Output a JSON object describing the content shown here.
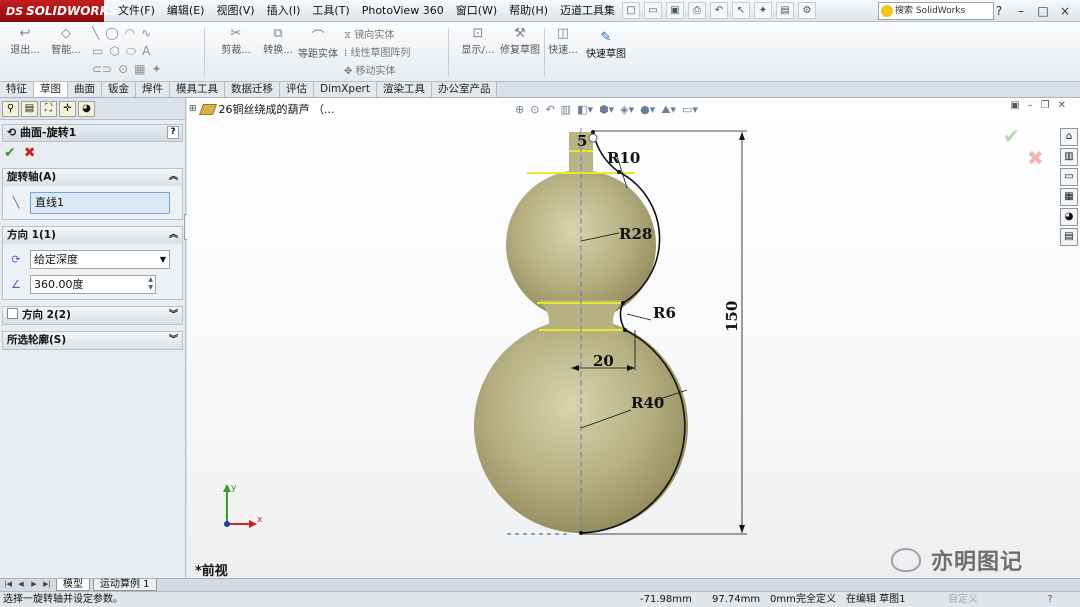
{
  "app": {
    "logo_prefix": "DS",
    "logo_text": "SOLIDWORKS"
  },
  "menu": [
    "文件(F)",
    "编辑(E)",
    "视图(V)",
    "插入(I)",
    "工具(T)",
    "PhotoView 360",
    "窗口(W)",
    "帮助(H)",
    "迈道工具集"
  ],
  "search": {
    "placeholder": "搜索 SolidWorks"
  },
  "window_controls": [
    "?",
    "–",
    "□",
    "×"
  ],
  "commands": {
    "exit_sketch": "退出...",
    "smart_dim": "智能...",
    "trim": "剪裁...",
    "convert": "转换...",
    "offset": "等距实体",
    "mirror": "镜向实体",
    "linear_pattern": "线性草图阵列",
    "move": "移动实体",
    "display": "显示/...",
    "repair": "修复草图",
    "quick_snap": "快速...",
    "rapid_sketch": "快速草图"
  },
  "tabs": [
    {
      "label": "特征",
      "active": false
    },
    {
      "label": "草图",
      "active": true
    },
    {
      "label": "曲面",
      "active": false
    },
    {
      "label": "钣金",
      "active": false
    },
    {
      "label": "焊件",
      "active": false
    },
    {
      "label": "模具工具",
      "active": false
    },
    {
      "label": "数据迁移",
      "active": false
    },
    {
      "label": "评估",
      "active": false
    },
    {
      "label": "DimXpert",
      "active": false
    },
    {
      "label": "渲染工具",
      "active": false
    },
    {
      "label": "办公室产品",
      "active": false
    }
  ],
  "property_manager": {
    "title": "曲面-旋转1",
    "help": "?",
    "axis_group": {
      "title": "旋转轴(A)",
      "value": "直线1"
    },
    "direction1": {
      "title": "方向 1(1)",
      "type": "给定深度",
      "angle": "360.00度"
    },
    "direction2": {
      "title": "方向 2(2)"
    },
    "contours": {
      "title": "所选轮廓(S)"
    }
  },
  "graphics": {
    "tree_item": "26铜丝绕成的葫芦 （...",
    "dims": {
      "top": "5",
      "r_top": "R10",
      "r_upper": "R28",
      "r_neck": "R6",
      "width": "20",
      "r_lower": "R40",
      "height": "150"
    },
    "view_name": "*前视",
    "watermark": "亦明图记",
    "axis_x": "x",
    "axis_y": "y"
  },
  "bottom_tabs": [
    {
      "label": "模型",
      "active": true
    },
    {
      "label": "运动算例 1",
      "active": false
    }
  ],
  "status": {
    "message": "选择一旋转轴并设定参数。",
    "x": "-71.98mm",
    "y": "97.74mm",
    "z": "0mm",
    "defined": "完全定义",
    "editing": "在编辑 草图1",
    "units": "自定义",
    "help": "?"
  },
  "colors": {
    "accent": "#2b66b8",
    "logo": "#c41e1e",
    "gourd": "#b6b083",
    "dimension": "#111111",
    "ok": "#3c9a2a",
    "cancel": "#c8262a"
  }
}
